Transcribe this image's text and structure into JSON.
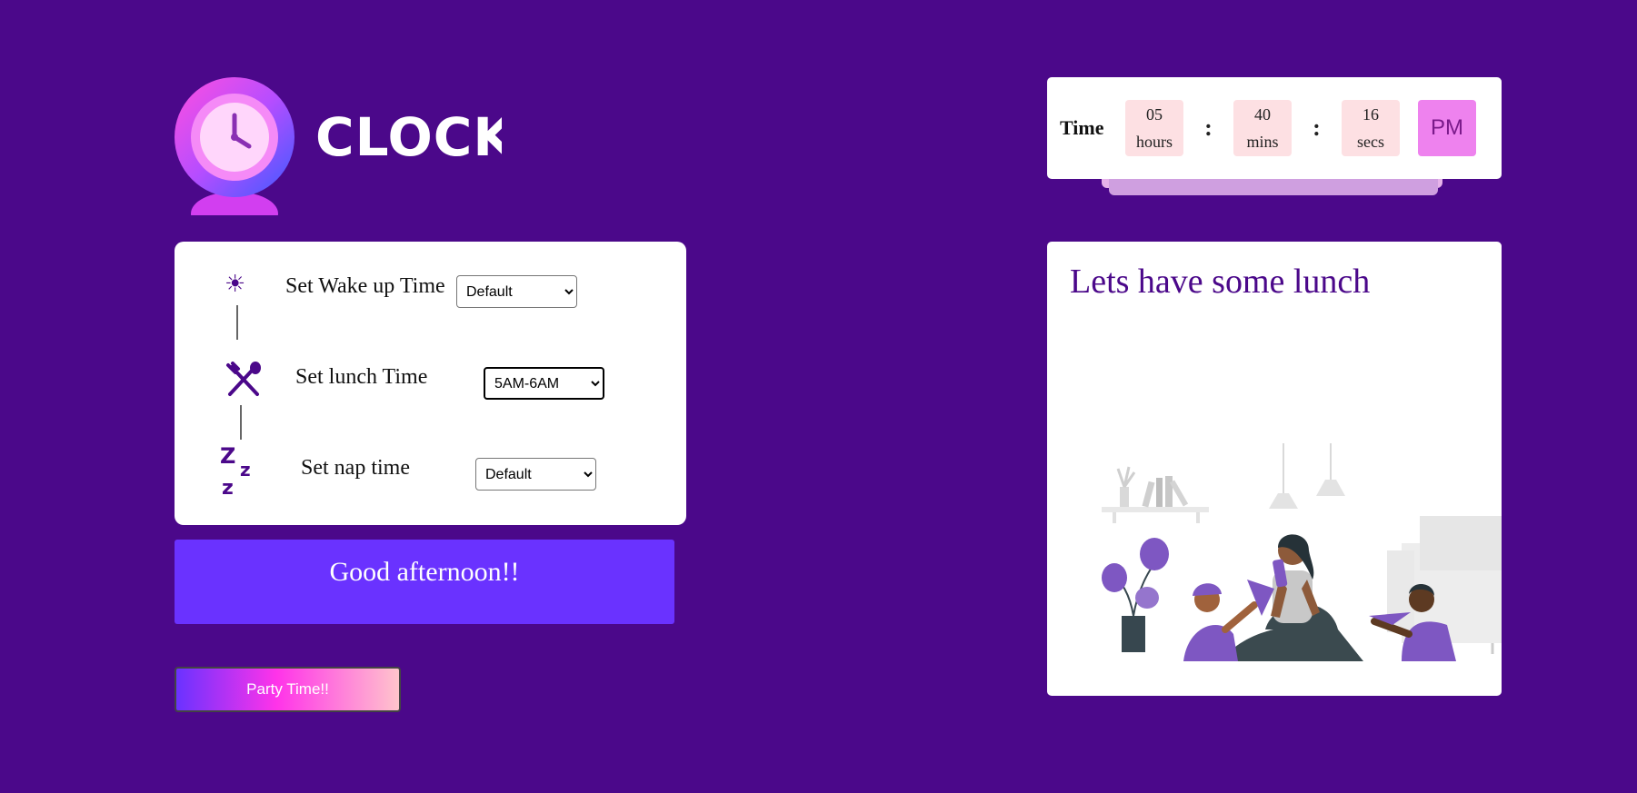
{
  "logo": {
    "text": "CLOCK",
    "icon": "clock-icon"
  },
  "time": {
    "label": "Time",
    "hours": "05",
    "hours_unit": "hours",
    "mins": "40",
    "mins_unit": "mins",
    "secs": "16",
    "secs_unit": "secs",
    "separator": ":",
    "ampm": "PM"
  },
  "settings": {
    "wake": {
      "label": "Set Wake up Time",
      "value": "Default",
      "icon": "sun-icon"
    },
    "lunch": {
      "label": "Set lunch Time",
      "value": "5AM-6AM",
      "icon": "fork-spoon-icon"
    },
    "nap": {
      "label": "Set nap time",
      "value": "Default",
      "icon": "sleep-zzz-icon"
    }
  },
  "greeting": "Good afternoon!!",
  "party_button": "Party Time!!",
  "message": {
    "title": "Lets have some lunch"
  },
  "colors": {
    "background": "#4b088a",
    "greeting_bg": "#6a32ff",
    "time_box": "#fde0e3",
    "ampm_box": "#ee82ee"
  }
}
